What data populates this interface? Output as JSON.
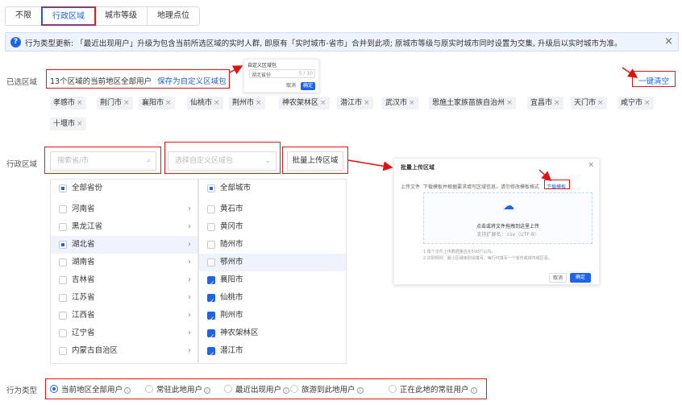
{
  "tabs": [
    {
      "label": "不限"
    },
    {
      "label": "行政区域"
    },
    {
      "label": "城市等级"
    },
    {
      "label": "地理点位"
    }
  ],
  "notice": {
    "text": "行为类型更新: 「最近出现用户」升级为包含当前所选区域的实时人群, 即原有「实时城市-省市」合并到此项; 原城市等级与原实时城市同时设置为交集, 升级后以实时城市为准。",
    "close": "×"
  },
  "selected": {
    "label": "已选区域",
    "summary": "13个区域的当前地区全部用户",
    "save_link": "保存为自定义区域包",
    "clear_link": "一键清空",
    "chips": [
      "孝感市",
      "荆门市",
      "襄阳市",
      "仙桃市",
      "荆州市",
      "神农架林区",
      "潜江市",
      "武汉市",
      "恩施土家族苗族自治州",
      "宜昌市",
      "天门市",
      "咸宁市",
      "十堰市"
    ]
  },
  "save_popup": {
    "title": "自定义区域包",
    "input_value": "湖北省份",
    "counter": "5 / 10",
    "cancel": "取消",
    "ok": "确定"
  },
  "region": {
    "label": "行政区域",
    "province_placeholder": "搜索省/市",
    "package_placeholder": "选择自定义区域包",
    "bulk_upload": "批量上传区域",
    "all_provinces": "全部省份",
    "provinces": [
      "河南省",
      "黑龙江省",
      "湖北省",
      "湖南省",
      "吉林省",
      "江苏省",
      "江西省",
      "辽宁省",
      "内蒙古自治区"
    ],
    "all_cities": "全部城市",
    "cities": [
      "黄石市",
      "黄冈市",
      "随州市",
      "鄂州市",
      "襄阳市",
      "仙桃市",
      "荆州市",
      "神农架林区",
      "潜江市"
    ]
  },
  "upload_dialog": {
    "title": "批量上传区域",
    "close": "×",
    "field_label": "上传文件",
    "hint": "下载模板并根据要求填写区域信息，请勿修改模板格式",
    "template_link": "下载模板",
    "drop_text": "点击或将文件拖拽到这里上传",
    "format_text": "支持扩展名：.csv（UTF-8）",
    "note1": "1.单个文件上传数据量应在500行以内；",
    "note2": "2.识别规则：最小区域级别请填写，每行仅填写一个省份或城市或区县。",
    "cancel": "取消",
    "ok": "确定"
  },
  "behavior": {
    "label": "行为类型",
    "options": [
      "当前地区全部用户",
      "常驻此地用户",
      "最近出现用户",
      "旅游到此地用户",
      "正在此地的常驻用户"
    ]
  },
  "colors": {
    "accent": "#1e63e8",
    "annotation": "#e11111"
  }
}
